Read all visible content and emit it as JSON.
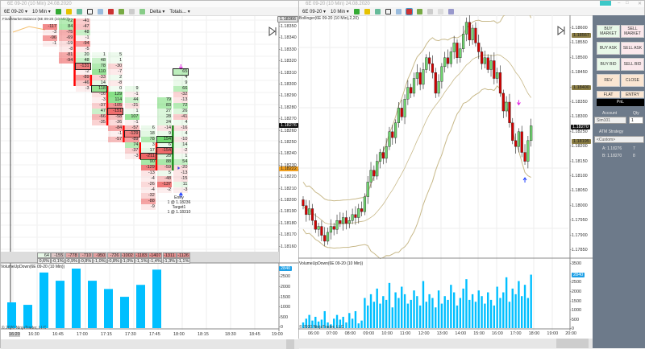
{
  "left_window": {
    "title": "6E 09-20 (10 Min)  24.08.2020",
    "toolbar": {
      "instrument": "6E 09-20 ▾",
      "interval": "10 Min ▾",
      "mode": "Delta ▾",
      "totals": "Totals... ▾"
    },
    "indicator_label": "Final Market Balance (6E 09-20 (10 Min))",
    "price_axis": [
      "1.18350",
      "1.18340",
      "1.18330",
      "1.18320",
      "1.18310",
      "1.18300",
      "1.18290",
      "1.18280",
      "1.18270",
      "1.18260",
      "1.18250",
      "1.18240",
      "1.18230",
      "1.18220",
      "1.18210",
      "1.18200",
      "1.18190",
      "1.18180",
      "1.18170",
      "1.18160"
    ],
    "current_price_label": "1.18276",
    "top_price_label": "1.18366",
    "entry_price_label": "1.18222",
    "footprint_columns": [
      {
        "start": 1,
        "values": [
          -117,
          -3,
          -96,
          -1
        ]
      },
      {
        "start": 0,
        "values": [
          72,
          84,
          -75,
          -69,
          -19,
          -8,
          -81,
          -94
        ]
      },
      {
        "start": 0,
        "values": [
          -41,
          -47,
          48,
          -1,
          -94,
          -5,
          20,
          48,
          -131,
          -2,
          -89,
          -46,
          -3
        ]
      },
      {
        "start": 6,
        "values": [
          1,
          48,
          78,
          110,
          -33,
          14,
          118,
          -16,
          -3,
          -37,
          47,
          -66,
          -35
        ]
      },
      {
        "start": 6,
        "values": [
          5,
          1,
          -30,
          -7,
          2,
          -8,
          0,
          129,
          114,
          -105,
          -151,
          -58,
          -26,
          -84,
          -1,
          -57
        ]
      },
      {
        "start": 12,
        "values": [
          9,
          -1,
          44,
          -21,
          1,
          107,
          -1,
          -57,
          -129,
          -89,
          74,
          -37,
          -3
        ]
      },
      {
        "start": 19,
        "values": [
          6,
          18,
          78,
          3,
          17,
          -211,
          90,
          -129,
          -13,
          -4,
          -26,
          -4,
          -32,
          -88,
          -9
        ]
      },
      {
        "start": 14,
        "values": [
          79,
          83,
          27,
          28,
          24,
          -14,
          9,
          154,
          6,
          -154,
          28,
          88,
          -59,
          5,
          -48,
          -137,
          -2
        ]
      },
      {
        "start": 9,
        "values": [
          65,
          4,
          9,
          66,
          -32,
          -13,
          72,
          26,
          -41,
          4,
          -16,
          4,
          -10,
          14,
          -2,
          1,
          54,
          -20,
          -13,
          -15,
          11,
          -3
        ]
      }
    ],
    "boxed_cells": [
      [
        2,
        8
      ],
      [
        3,
        12
      ],
      [
        4,
        16
      ],
      [
        5,
        20
      ],
      [
        6,
        24
      ],
      [
        7,
        21
      ],
      [
        7,
        23
      ],
      [
        8,
        9
      ]
    ],
    "poc_bars": [
      {
        "col": 1,
        "from": 0,
        "to": 11,
        "color": "#ff0000"
      },
      {
        "col": 2,
        "from": 10,
        "to": 11,
        "color": "#ff0000"
      },
      {
        "col": 3,
        "from": 12,
        "to": 18,
        "color": "#ff0000"
      },
      {
        "col": 4,
        "from": 19,
        "to": 21,
        "color": "#ff0000"
      },
      {
        "col": 5,
        "from": 22,
        "to": 24,
        "color": "#ff0000"
      },
      {
        "col": 6,
        "from": 22,
        "to": 26,
        "color": "#ff0000"
      },
      {
        "col": 7,
        "from": 19,
        "to": 26,
        "color": "#1a8a1a"
      }
    ],
    "entry_annotation": {
      "line1": "Entry",
      "line2": "1 @ 1.18236",
      "line3": "Target1",
      "line4": "1 @ 1.18310"
    },
    "delta_totals": [
      "64",
      "-155",
      "-778",
      "-710",
      "-950",
      "-726",
      "-1002",
      "-1183",
      "-1407",
      "-1311",
      "-1126"
    ],
    "delta_percent": [
      "0,6%",
      "-0,1%",
      "-0,9%",
      "-0,8%",
      "-1,0%",
      "-0,8%",
      "-1,0%",
      "-1,1%",
      "-1,4%",
      "-1,3%",
      "-1,1%"
    ],
    "volume_label": "VolumeUpDown(6E 09-20 (10 Min))",
    "volume_axis": [
      "2500",
      "2000",
      "1500",
      "1000",
      "500",
      "0"
    ],
    "volume_current": "2840",
    "volumes": [
      1250,
      1130,
      2700,
      2300,
      2890,
      2300,
      1900,
      1520,
      2100,
      2840
    ],
    "copyright": "© 2020 NinjaTrader, LLC",
    "time_axis": [
      "16:20",
      "16:30",
      "16:45",
      "17:00",
      "17:15",
      "17:30",
      "17:45",
      "18:00",
      "18:15",
      "18:30",
      "18:45",
      "19:00"
    ]
  },
  "right_window": {
    "toolbar": {
      "instrument": "6E 09-20 ▾",
      "interval": "10 Min ▾"
    },
    "indicator_label": "Bollinger(6E 09-20 (10 Min),2,20)",
    "price_axis": [
      "1.18600",
      "1.18550",
      "1.18500",
      "1.18450",
      "1.18400",
      "1.18350",
      "1.18300",
      "1.18250",
      "1.18200",
      "1.18150",
      "1.18100",
      "1.18050",
      "1.18000",
      "1.17950",
      "1.17900",
      "1.17850"
    ],
    "current_price_label": "1.18270",
    "band_labels": [
      "1.18567",
      "1.18400",
      "1.18195"
    ],
    "closes": [
      1.18,
      1.1797,
      1.1799,
      1.1795,
      1.1792,
      1.1793,
      1.179,
      1.1788,
      1.1791,
      1.1793,
      1.1792,
      1.1795,
      1.1794,
      1.1796,
      1.1794,
      1.1795,
      1.1797,
      1.1796,
      1.1799,
      1.1798,
      1.1803,
      1.1808,
      1.1812,
      1.181,
      1.1815,
      1.1818,
      1.1816,
      1.182,
      1.1825,
      1.1823,
      1.1828,
      1.1833,
      1.183,
      1.1836,
      1.184,
      1.1838,
      1.1843,
      1.1845,
      1.1841,
      1.1846,
      1.185,
      1.1848,
      1.1845,
      1.1838,
      1.1842,
      1.1847,
      1.185,
      1.1848,
      1.1852,
      1.1855,
      1.185,
      1.1853,
      1.1858,
      1.1862,
      1.1856,
      1.186,
      1.1855,
      1.1852,
      1.1848,
      1.185,
      1.1846,
      1.1849,
      1.1843,
      1.1845,
      1.1838,
      1.1832,
      1.1835,
      1.1828,
      1.1822,
      1.182,
      1.1825,
      1.1818,
      1.1815,
      1.1822,
      1.1827
    ],
    "volume_label": "VolumeUpDown(6E 09-20 (10 Min))",
    "volume_axis": [
      "3500",
      "2500",
      "2000",
      "1500",
      "1000",
      "500",
      "0"
    ],
    "volume_current": "2840",
    "volumes": [
      300,
      500,
      700,
      400,
      600,
      350,
      450,
      900,
      300,
      200,
      500,
      700,
      450,
      600,
      300,
      800,
      500,
      900,
      250,
      400,
      1600,
      1200,
      1800,
      1400,
      2100,
      1300,
      1700,
      1500,
      2400,
      1100,
      1900,
      1600,
      2200,
      1800,
      1300,
      1500,
      2000,
      1700,
      1200,
      2500,
      1400,
      1800,
      1600,
      1100,
      2000,
      1300,
      1700,
      1500,
      2300,
      1900,
      1200,
      1600,
      2100,
      2600,
      1500,
      1800,
      1400,
      2000,
      1700,
      1300,
      1900,
      1500,
      1200,
      2200,
      1600,
      1900,
      2700,
      1400,
      2100,
      1800,
      2500,
      1700,
      2300,
      1600,
      2840
    ],
    "copyright": "© 2020 NinjaTrader, LLC",
    "time_axis": [
      "06:00",
      "07:00",
      "08:00",
      "09:00",
      "10:00",
      "11:00",
      "12:00",
      "13:00",
      "14:00",
      "15:00",
      "16:00",
      "17:00",
      "18:00",
      "19:00",
      "20:00"
    ]
  },
  "order_entry": {
    "buy_market": "BUY MARKET",
    "sell_market": "SELL MARKET",
    "buy_ask": "BUY ASK",
    "sell_ask": "SELL ASK",
    "buy_bid": "BUY BID",
    "sell_bid": "SELL BID",
    "rev": "REV",
    "close": "CLOSE",
    "flat": "FLAT",
    "entry": "ENTRY",
    "pnl": "PnL",
    "account_label": "Account",
    "qty_label": "Qty",
    "account_value": "Sim101",
    "qty_value": "1",
    "atm_label": "ATM Strategy",
    "atm_value": "<Custom>",
    "ask_line": "A: 1.18276",
    "ask_size": "7",
    "bid_line": "B: 1.18270",
    "bid_size": "8"
  },
  "colors": {
    "up": "#6fd46f",
    "down": "#d40000",
    "band": "#c8b98a",
    "volume": "#00bfff",
    "panel": "#6d7a8a"
  }
}
